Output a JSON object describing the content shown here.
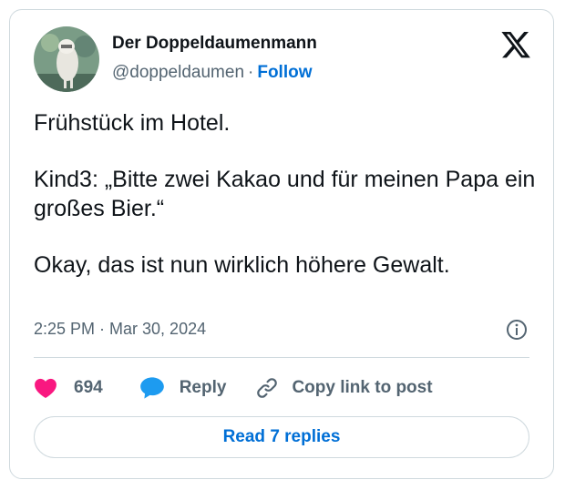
{
  "author": {
    "name": "Der Doppeldaumenmann",
    "handle": "@doppeldaumen",
    "separator": "·",
    "follow_label": "Follow"
  },
  "tweet": {
    "lines": [
      "Frühstück im Hotel.",
      "Kind3: „Bitte zwei Kakao und für meinen Papa ein großes Bier.“",
      "Okay, das ist nun wirklich höhere Gewalt."
    ],
    "timestamp": "2:25 PM · Mar 30, 2024"
  },
  "actions": {
    "like_count": "694",
    "reply_label": "Reply",
    "copy_link_label": "Copy link to post"
  },
  "read_replies_label": "Read 7 replies",
  "icons": {
    "platform": "x-logo-icon",
    "info": "info-icon",
    "like": "heart-icon",
    "reply": "speech-bubble-icon",
    "copy": "link-icon"
  },
  "colors": {
    "accent": "#006fd6",
    "like": "#f91880",
    "reply": "#1d9bf0",
    "muted": "#536471",
    "border": "#cfd9de"
  }
}
